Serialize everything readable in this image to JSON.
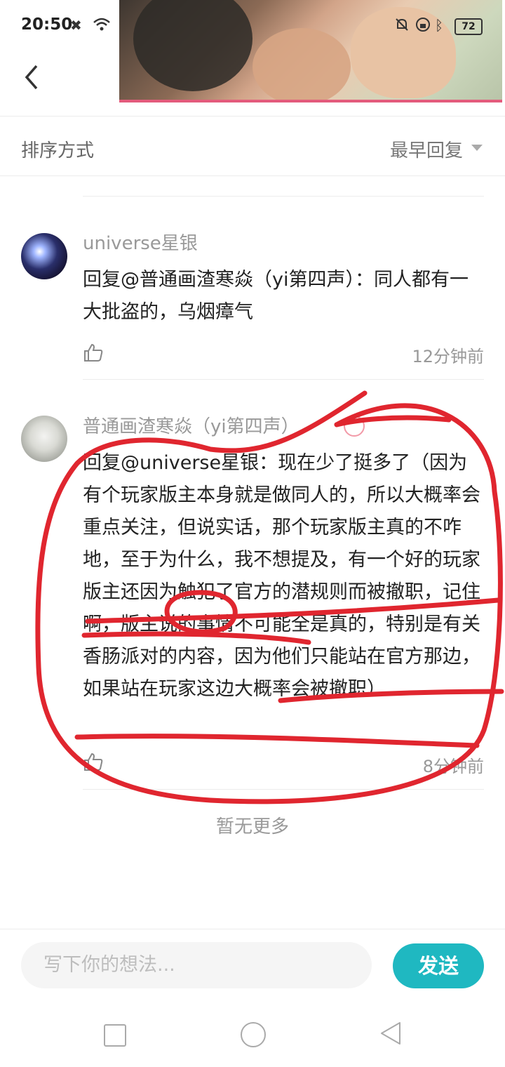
{
  "status_bar": {
    "time": "20:50",
    "battery": "72"
  },
  "header": {
    "back_icon": "chevron-left-icon"
  },
  "sort": {
    "label": "排序方式",
    "value": "最早回复"
  },
  "comments": [
    {
      "username": "universe星银",
      "text": "回复@普通画渣寒焱（yi第四声）：同人都有一大批盗的，乌烟瘴气",
      "time": "12分钟前"
    },
    {
      "username": "普通画渣寒焱（yi第四声）",
      "text": "回复@universe星银：现在少了挺多了（因为有个玩家版主本身就是做同人的，所以大概率会重点关注，但说实话，那个玩家版主真的不咋地，至于为什么，我不想提及，有一个好的玩家版主还因为触犯了官方的潜规则而被撤职，记住啊，版主说的事情不可能全是真的，特别是有关香肠派对的内容，因为他们只能站在官方那边，如果站在玩家这边大概率会被撤职）",
      "time": "8分钟前"
    }
  ],
  "footer_note": "暂无更多",
  "composer": {
    "placeholder": "写下你的想法...",
    "send_label": "发送"
  },
  "colors": {
    "accent": "#1fb8c1",
    "annotation_red": "#e0262f"
  }
}
